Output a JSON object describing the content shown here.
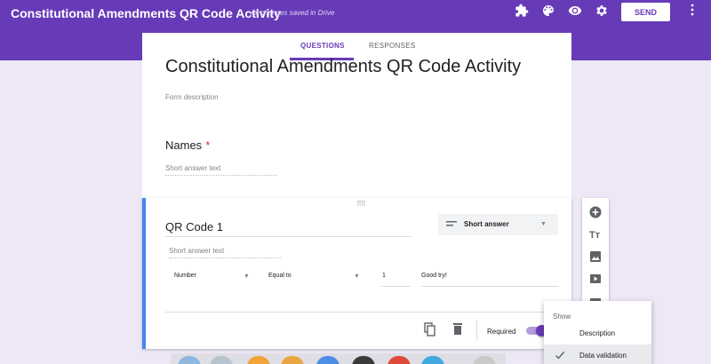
{
  "header": {
    "title": "Constitutional Amendments QR Code Activity",
    "save_status": "All changes saved in Drive",
    "send_label": "SEND",
    "icons": [
      "puzzle-icon",
      "palette-icon",
      "eye-icon",
      "gear-icon",
      "more-vert-icon"
    ]
  },
  "tabs": [
    {
      "label": "QUESTIONS",
      "active": true
    },
    {
      "label": "RESPONSES",
      "active": false
    }
  ],
  "form": {
    "title": "Constitutional Amendments QR Code Activity",
    "description_placeholder": "Form description"
  },
  "questions": [
    {
      "title": "Names",
      "required_marker": "*",
      "answer_hint": "Short answer text"
    },
    {
      "title": "QR Code 1",
      "answer_hint": "Short answer text",
      "type_label": "Short answer",
      "validation": {
        "type": "Number",
        "condition": "Equal to",
        "value": "1",
        "error_text": "Good try!"
      },
      "required_label": "Required",
      "required": true
    }
  ],
  "menu": {
    "header": "Show",
    "items": [
      {
        "label": "Description",
        "checked": false
      },
      {
        "label": "Data validation",
        "checked": true
      }
    ]
  },
  "colors": {
    "brand": "#673ab7",
    "background": "#ede7f6",
    "active_border": "#4285f4"
  }
}
